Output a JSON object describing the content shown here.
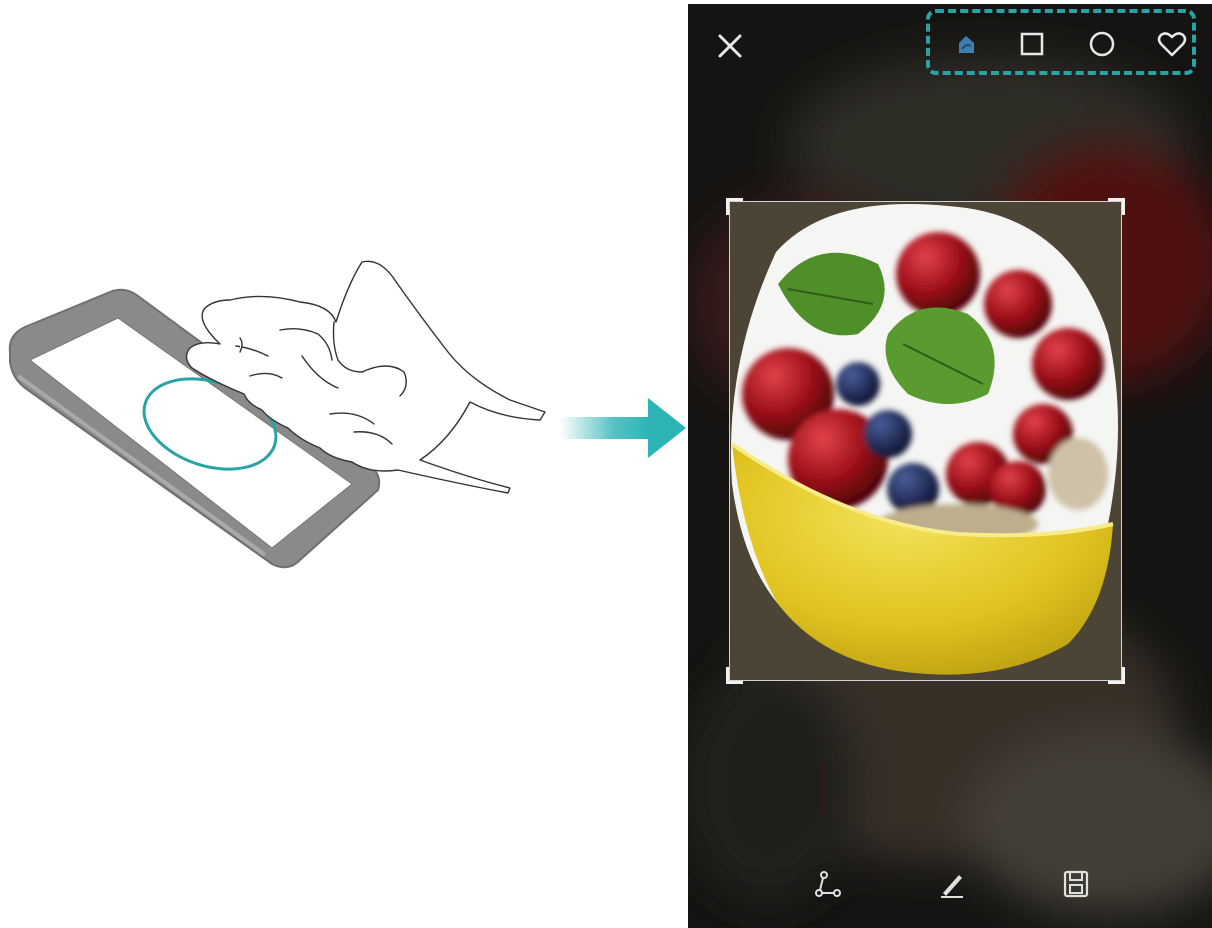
{
  "screen": {
    "topbar": {
      "close_icon": "close-icon",
      "shape_selector": {
        "highlight_color": "#2aa3a6",
        "options": [
          {
            "icon": "freeform-shape-icon",
            "selected": true
          },
          {
            "icon": "square-shape-icon",
            "selected": false
          },
          {
            "icon": "circle-shape-icon",
            "selected": false
          },
          {
            "icon": "heart-shape-icon",
            "selected": false
          }
        ]
      }
    },
    "bottombar": {
      "actions": [
        {
          "icon": "share-icon"
        },
        {
          "icon": "edit-pen-icon"
        },
        {
          "icon": "save-icon"
        }
      ]
    }
  },
  "colors": {
    "accent": "#2aa3a6",
    "selected_icon": "#3f7fb0"
  }
}
